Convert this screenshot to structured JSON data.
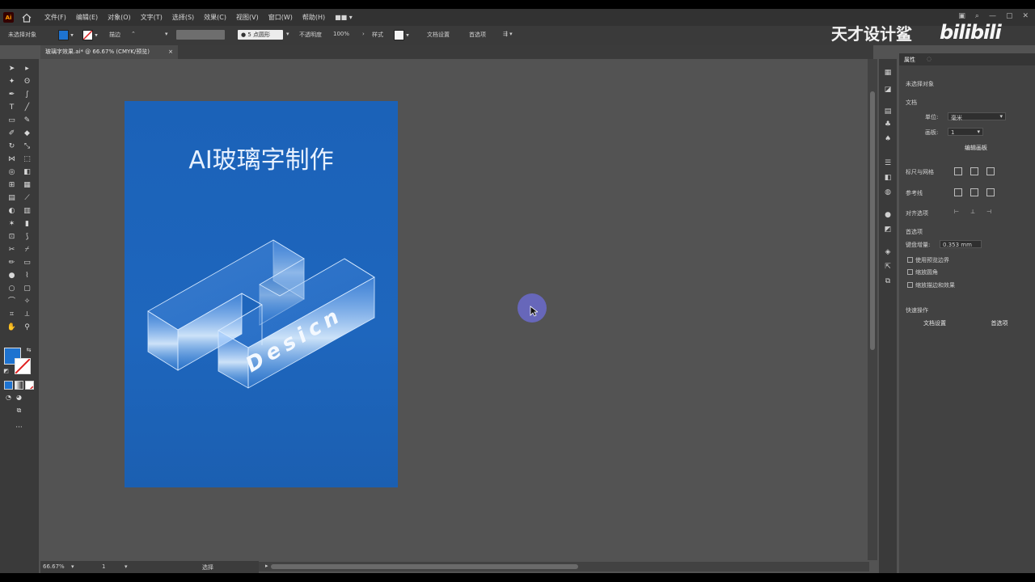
{
  "menubar": {
    "app_icon": "Ai",
    "items": [
      "文件(F)",
      "编辑(E)",
      "对象(O)",
      "文字(T)",
      "选择(S)",
      "效果(C)",
      "视图(V)",
      "窗口(W)",
      "帮助(H)",
      "■■ ▾"
    ]
  },
  "controlbar": {
    "selection": "未选择对象",
    "stroke_label": "描边",
    "brush": "5 点圆形",
    "opacity_label": "不透明度",
    "opacity_value": "100%",
    "style_label": "样式",
    "doc_setup": "文档设置",
    "preferences": "首选项"
  },
  "document_tab": {
    "title": "玻璃字效果.ai* @ 66.67% (CMYK/预览)",
    "close": "×"
  },
  "artboard": {
    "title": "AI玻璃字制作",
    "letter": "H",
    "word": "Desicn",
    "bg_color": "#1e64ba"
  },
  "statusbar": {
    "zoom": "66.67%",
    "artboard_num": "1",
    "tool": "选择"
  },
  "watermark": {
    "text": "天才设计鲨",
    "logo": "bilibili"
  },
  "panel": {
    "tab_properties": "属性",
    "no_selection": "未选择对象",
    "doc_section": "文档",
    "units_label": "单位:",
    "units_value": "毫米",
    "artboard_label": "画板:",
    "artboard_value": "1",
    "edit_artboards": "编辑画板",
    "rulers_grid": "标尺与网格",
    "guides": "参考线",
    "align": "对齐选项",
    "preferences_section": "首选项",
    "keyboard_increment_label": "键盘增量:",
    "keyboard_increment_value": "0.353 mm",
    "opt1": "使用预览边界",
    "opt2": "缩放圆角",
    "opt3": "缩放描边和效果",
    "quick_actions": "快速操作",
    "doc_setup_button": "文档设置",
    "preferences_button": "首选项"
  },
  "colors": {
    "fill": "#1e73d0",
    "ui_dark": "#323232",
    "canvas": "#535353"
  }
}
